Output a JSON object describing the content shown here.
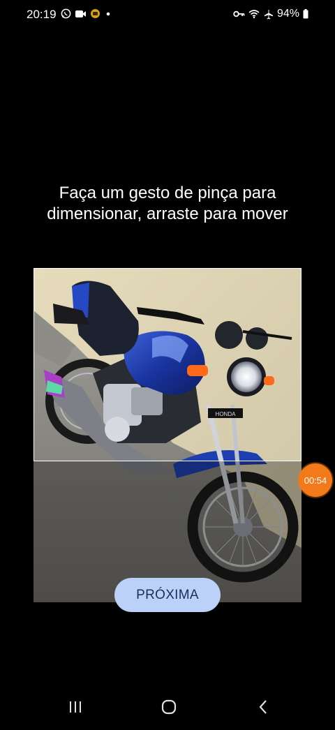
{
  "status_bar": {
    "time": "20:19",
    "left_icons": [
      "whatsapp-icon",
      "video-camera-icon",
      "app-notification-icon",
      "dot-icon"
    ],
    "right_icons": [
      "vpn-key-icon",
      "wifi-icon",
      "airplane-mode-icon",
      "battery-icon"
    ],
    "battery": "94%"
  },
  "instruction": {
    "line1": "Faça um gesto de pinça para",
    "line2": "dimensionar, arraste para mover"
  },
  "photo": {
    "subject": "Blue Honda motorcycle parked on concrete",
    "brand_label": "HONDA"
  },
  "recording_timer": "00:54",
  "next_button_label": "PRÓXIMA",
  "nav_bar": {
    "recents": "recents-icon",
    "home": "home-icon",
    "back": "back-icon"
  },
  "colors": {
    "background": "#000000",
    "button_bg": "#bcd1f8",
    "button_text": "#1b2f5c",
    "timer_bg": "#f27a1a"
  }
}
